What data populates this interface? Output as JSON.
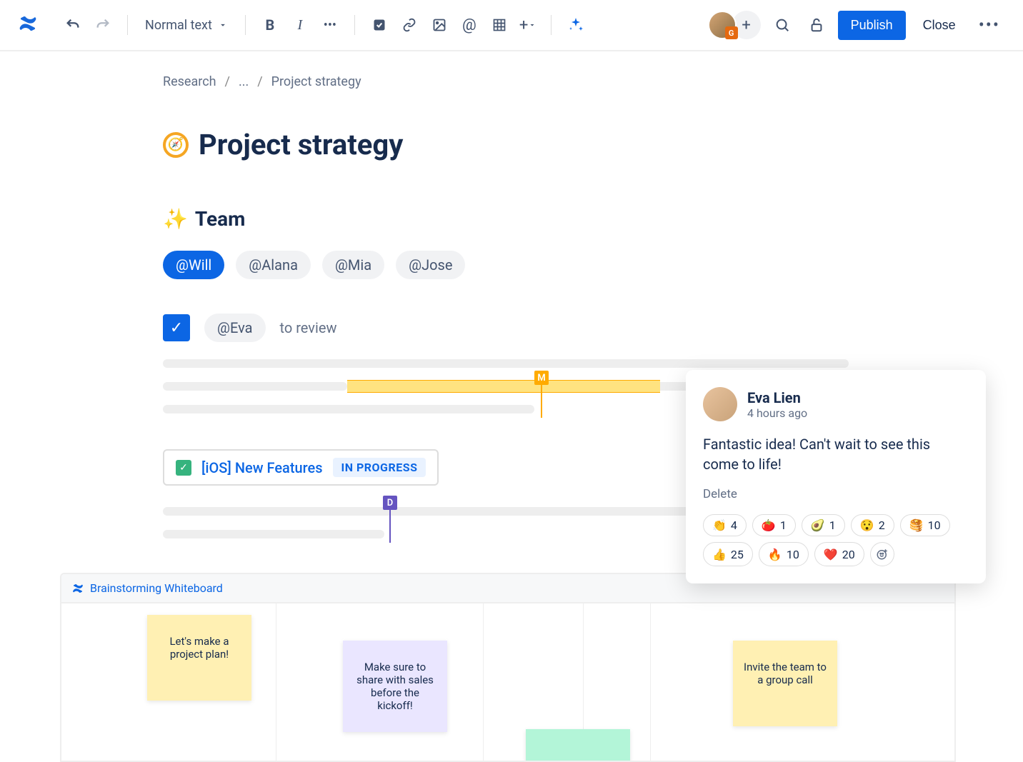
{
  "toolbar": {
    "textStyle": "Normal text",
    "publish": "Publish",
    "close": "Close",
    "avatarBadge": "G"
  },
  "breadcrumb": {
    "root": "Research",
    "mid": "...",
    "current": "Project strategy"
  },
  "page": {
    "title": "Project strategy",
    "teamHeading": "Team",
    "mentions": [
      "@Will",
      "@Alana",
      "@Mia",
      "@Jose"
    ],
    "reviewer": "@Eva",
    "reviewLabel": "to review",
    "cursorM": "M",
    "cursorD": "D",
    "jira": {
      "title": "[iOS] New Features",
      "status": "IN PROGRESS"
    }
  },
  "whiteboard": {
    "title": "Brainstorming Whiteboard",
    "stickies": [
      "Let's make a project plan!",
      "Make sure to share with sales before the kickoff!",
      "Invite the team to a group call"
    ]
  },
  "comment": {
    "author": "Eva Lien",
    "time": "4 hours ago",
    "body": "Fantastic idea! Can't wait to see this come to life!",
    "delete": "Delete",
    "reactions": [
      {
        "emoji": "👏",
        "count": 4
      },
      {
        "emoji": "🍅",
        "count": 1
      },
      {
        "emoji": "🥑",
        "count": 1
      },
      {
        "emoji": "😯",
        "count": 2
      },
      {
        "emoji": "🥞",
        "count": 10
      },
      {
        "emoji": "👍",
        "count": 25
      },
      {
        "emoji": "🔥",
        "count": 10
      },
      {
        "emoji": "❤️",
        "count": 20
      }
    ]
  }
}
